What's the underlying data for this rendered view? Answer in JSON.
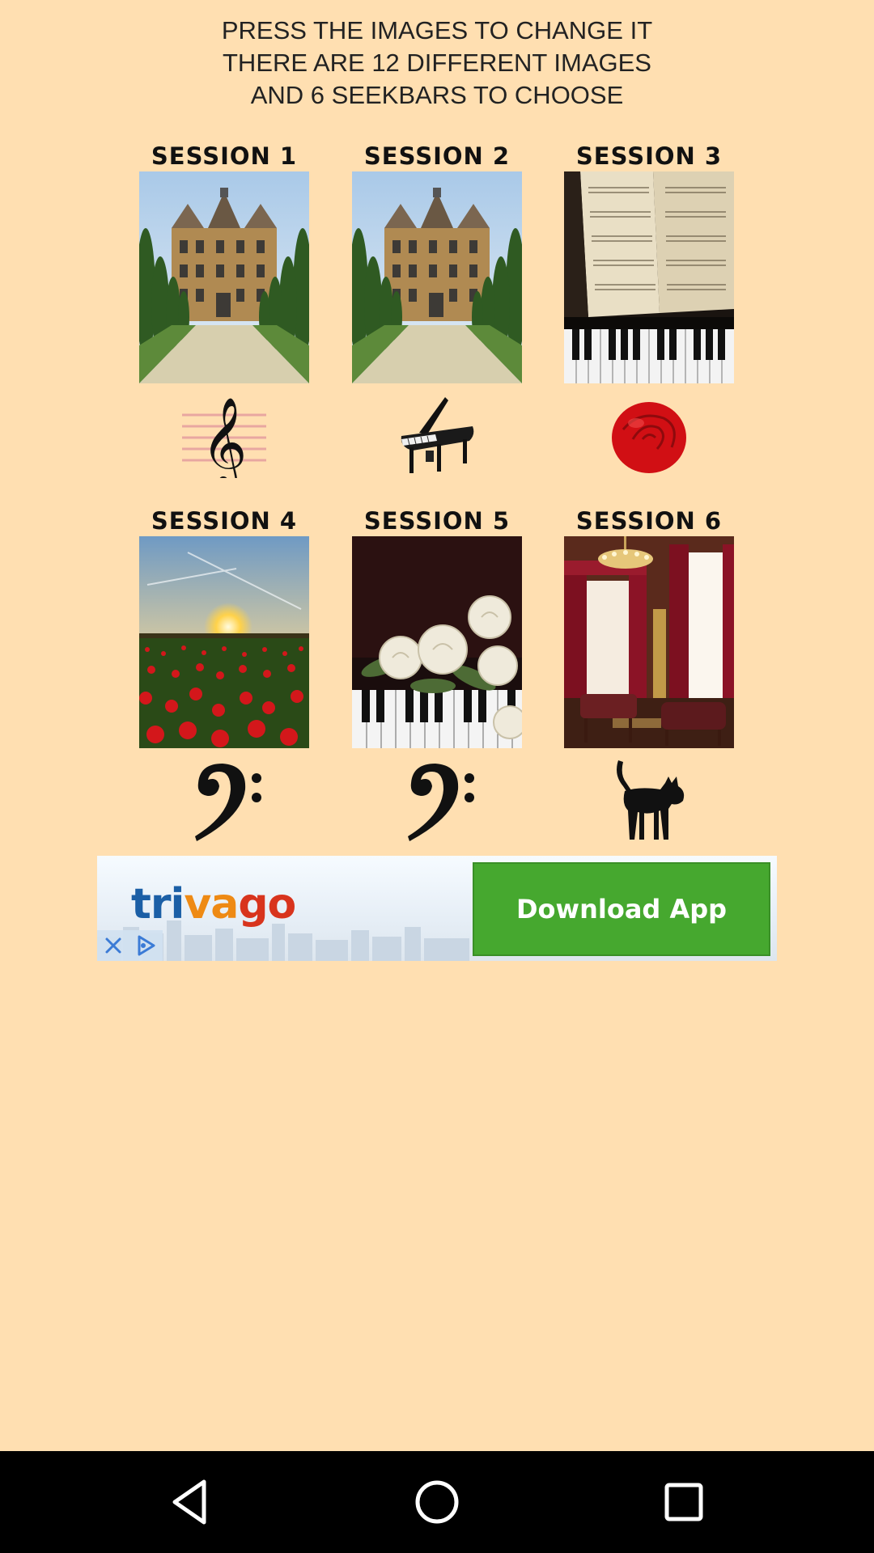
{
  "instructions": {
    "line1": "PRESS THE IMAGES TO CHANGE IT",
    "line2": "THERE ARE 12 DIFFERENT IMAGES",
    "line3": "AND 6 SEEKBARS TO CHOOSE"
  },
  "sessions": [
    {
      "title": "SESSION 1",
      "image": "mansion-garden-photo",
      "icon": "treble-clef-icon"
    },
    {
      "title": "SESSION 2",
      "image": "mansion-garden-photo",
      "icon": "grand-piano-icon"
    },
    {
      "title": "SESSION 3",
      "image": "sheet-music-piano-photo",
      "icon": "rose-icon"
    },
    {
      "title": "SESSION 4",
      "image": "sunset-poppy-field-photo",
      "icon": "bass-clef-icon"
    },
    {
      "title": "SESSION 5",
      "image": "white-roses-piano-photo",
      "icon": "bass-clef-icon"
    },
    {
      "title": "SESSION 6",
      "image": "chandelier-room-photo",
      "icon": "cat-icon"
    }
  ],
  "ad": {
    "logo_part1": "tri",
    "logo_part2": "va",
    "logo_part3": "go",
    "cta_label": "Download App",
    "colors": {
      "cta": "#46a82f",
      "logo_blue": "#1b5fa6",
      "logo_orange": "#ee8a14",
      "logo_red": "#d8341d"
    }
  },
  "navbar": {
    "buttons": [
      "back-icon",
      "home-icon",
      "recents-icon"
    ]
  },
  "colors": {
    "background": "#ffdfb1",
    "navbar": "#000000"
  }
}
